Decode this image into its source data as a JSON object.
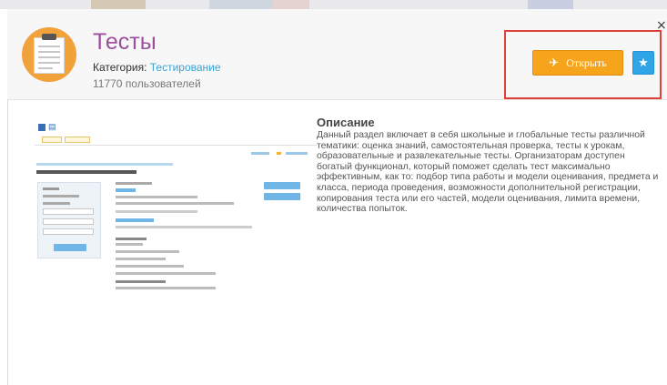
{
  "app": {
    "title": "Тесты",
    "category_label": "Категория: ",
    "category_value": "Тестирование",
    "users": "11770 пользователей",
    "icon": "clipboard-checklist-icon"
  },
  "actions": {
    "open_label": "Открыть",
    "open_icon": "paper-plane-icon",
    "favorite_icon": "star-icon",
    "close_glyph": "×"
  },
  "description": {
    "title": "Описание",
    "body": "Данный раздел включает в себя школьные и глобальные тесты различной тематики: оценка знаний, самостоятельная проверка, тесты к урокам, образовательные и развлекательные тесты. Организаторам доступен богатый функционал, который поможет сделать тест максимально эффективным, как то: подбор типа работы и модели оценивания, предмета и класса, периода проведения, возможности дополнительной регистрации, копирования теста или его частей, модели оценивания, лимита времени, количества попыток."
  },
  "colors": {
    "accent_purple": "#9c4f9c",
    "link_blue": "#3aa3d6",
    "open_orange": "#f7a41d",
    "fav_blue": "#2fa4e7",
    "highlight_red": "#e0403a"
  }
}
